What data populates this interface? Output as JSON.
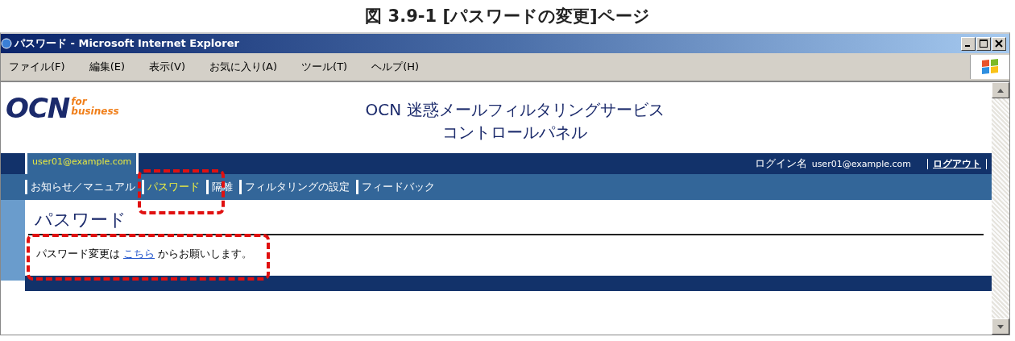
{
  "caption": "図 3.9-1 [パスワードの変更]ページ",
  "window": {
    "title": "パスワード - Microsoft Internet Explorer"
  },
  "menu": [
    "ファイル(F)",
    "編集(E)",
    "表示(V)",
    "お気に入り(A)",
    "ツール(T)",
    "ヘルプ(H)"
  ],
  "logo": {
    "main": "OCN",
    "sub_1": "for",
    "sub_2": "business"
  },
  "page_title": [
    "OCN 迷惑メールフィルタリングサービス",
    "コントロールパネル"
  ],
  "user_tab": "user01@example.com",
  "login": {
    "label": "ログイン名",
    "user": "user01@example.com",
    "logout": "ログアウト"
  },
  "nav": [
    {
      "label": "お知らせ／マニュアル",
      "selected": false
    },
    {
      "label": "パスワード",
      "selected": true
    },
    {
      "label": "隔離",
      "selected": false
    },
    {
      "label": "フィルタリングの設定",
      "selected": false
    },
    {
      "label": "フィードバック",
      "selected": false
    }
  ],
  "heading": "パスワード",
  "message": {
    "before": "パスワード変更は",
    "link": "こちら",
    "after": "からお願いします。"
  }
}
